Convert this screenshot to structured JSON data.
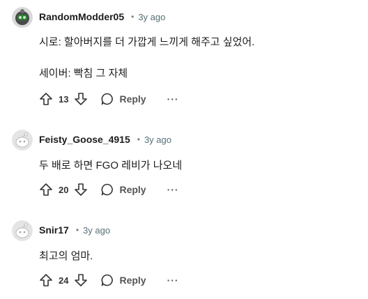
{
  "comments": [
    {
      "username": "RandomModder05",
      "separator": "•",
      "age": "3y ago",
      "lines": [
        "시로: 할아버지를 더 가깝게 느끼게 해주고 싶었어.",
        "세이버: 빡침 그 자체"
      ],
      "votes": "13",
      "reply_label": "Reply",
      "more_label": "···",
      "avatar": "custom-avatar"
    },
    {
      "username": "Feisty_Goose_4915",
      "separator": "•",
      "age": "3y ago",
      "lines": [
        "두 배로 하면 FGO 레비가 나오네"
      ],
      "votes": "20",
      "reply_label": "Reply",
      "more_label": "···",
      "avatar": "default-snoo-avatar"
    },
    {
      "username": "Snir17",
      "separator": "•",
      "age": "3y ago",
      "lines": [
        "최고의 엄마."
      ],
      "votes": "24",
      "reply_label": "Reply",
      "more_label": "···",
      "avatar": "default-snoo-avatar"
    }
  ],
  "icons": {
    "upvote": "upvote-arrow-icon",
    "downvote": "downvote-arrow-icon",
    "reply": "speech-bubble-icon",
    "more": "ellipsis-icon"
  }
}
